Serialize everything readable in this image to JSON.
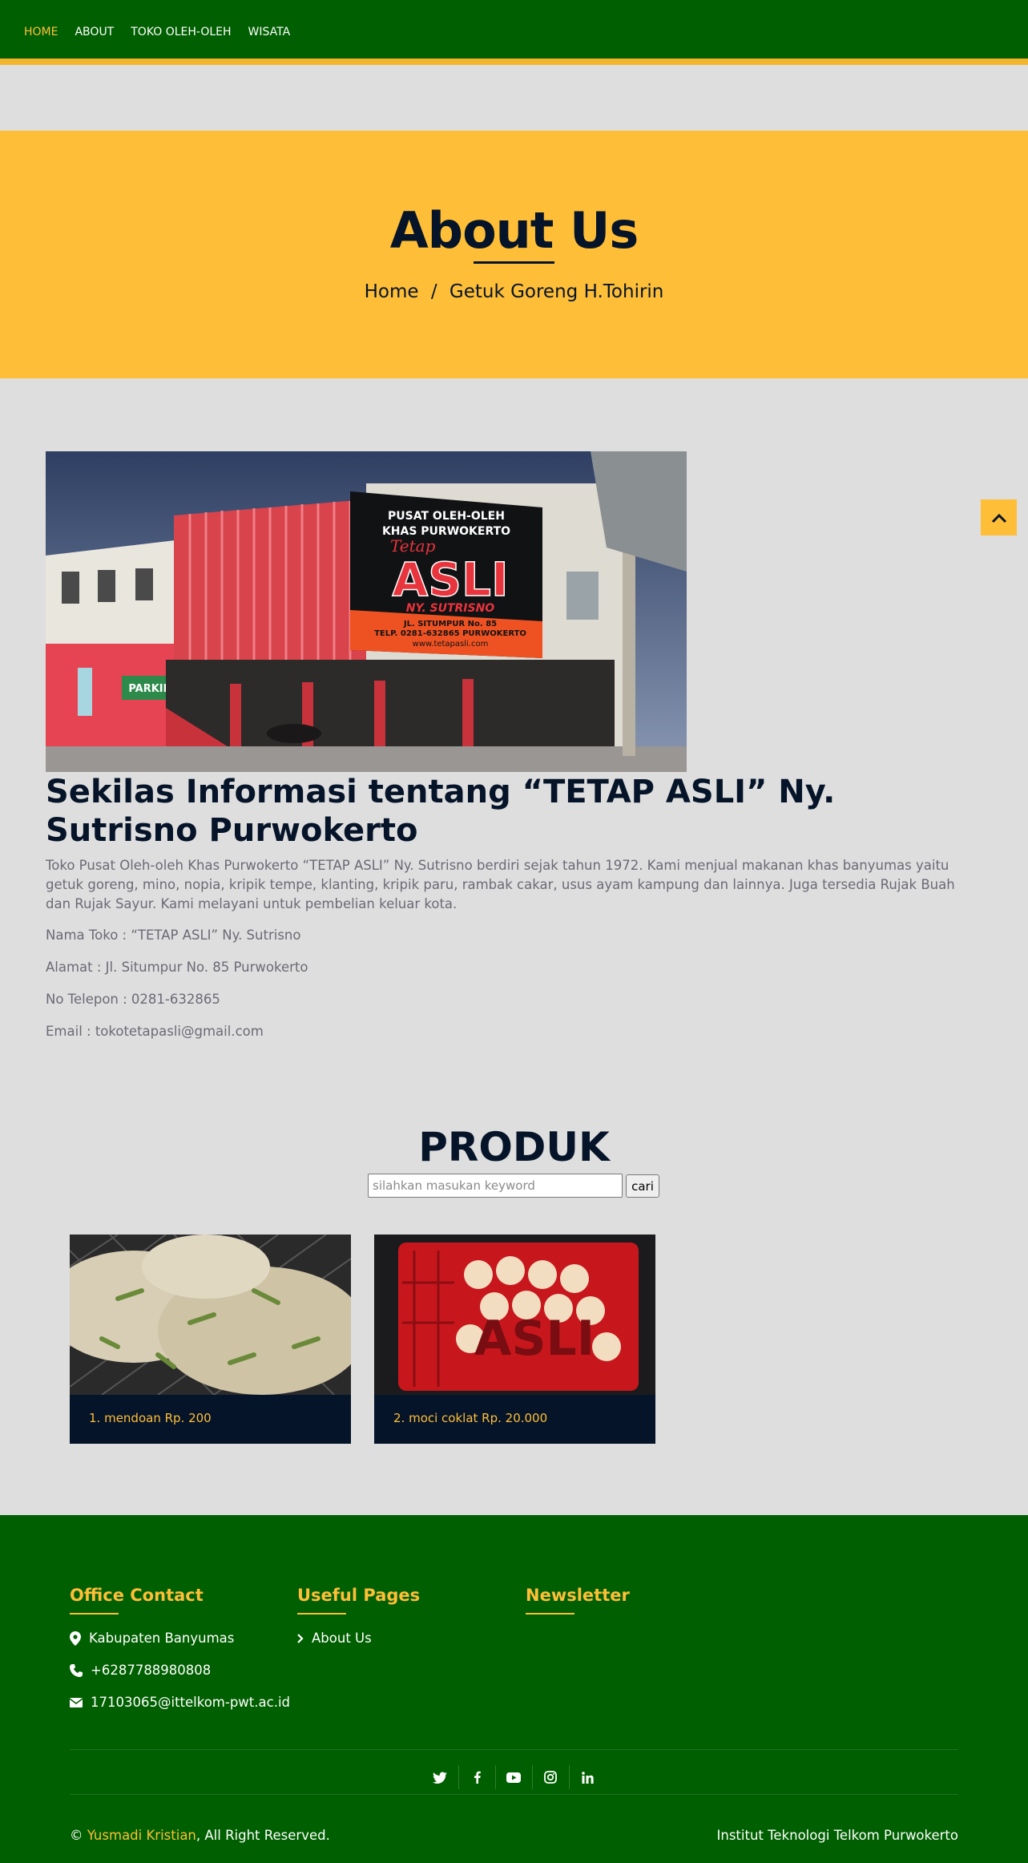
{
  "nav": {
    "items": [
      {
        "label": "HOME",
        "active": true
      },
      {
        "label": "ABOUT",
        "active": false
      },
      {
        "label": "TOKO OLEH-OLEH",
        "active": false
      },
      {
        "label": "WISATA",
        "active": false
      }
    ]
  },
  "hero": {
    "title": "About Us",
    "breadcrumb": {
      "home": "Home",
      "separator": "/",
      "current": "Getuk Goreng H.Tohirin"
    }
  },
  "store_photo": {
    "sign_line1": "PUSAT OLEH-OLEH",
    "sign_line2": "KHAS PURWOKERTO",
    "sign_script": "Tetap",
    "sign_brand": "ASLI",
    "sign_owner": "NY. SUTRISNO",
    "sign_address": "JL. SITUMPUR No. 85",
    "sign_phone": "TELP. 0281-632865 PURWOKERTO",
    "sign_web": "www.tetapasli.com",
    "parkir": "PARKIR"
  },
  "about": {
    "heading": "Sekilas Informasi tentang “TETAP ASLI” Ny. Sutrisno Purwokerto",
    "description": "Toko Pusat Oleh-oleh Khas Purwokerto “TETAP ASLI” Ny. Sutrisno berdiri sejak tahun 1972. Kami menjual makanan khas banyumas yaitu getuk goreng, mino, nopia, kripik tempe, klanting, kripik paru, rambak cakar, usus ayam kampung dan lainnya. Juga tersedia Rujak Buah dan Rujak Sayur. Kami melayani untuk pembelian keluar kota.",
    "store_name": "Nama Toko : “TETAP ASLI” Ny. Sutrisno",
    "address": "Alamat : Jl. Situmpur No. 85 Purwokerto",
    "phone": "No Telepon : 0281-632865",
    "email": "Email : tokotetapasli@gmail.com"
  },
  "produk": {
    "title": "PRODUK",
    "search_placeholder": "silahkan masukan keyword",
    "search_value": "",
    "search_button": "cari",
    "items": [
      {
        "label": "1. mendoan Rp. 200"
      },
      {
        "label": "2. moci coklat Rp. 20.000"
      }
    ],
    "moci_brand": "ASLI"
  },
  "footer": {
    "office": {
      "heading": "Office Contact",
      "location": "Kabupaten Banyumas",
      "phone": "+6287788980808",
      "email": "17103065@ittelkom-pwt.ac.id"
    },
    "useful": {
      "heading": "Useful Pages",
      "links": [
        "About Us"
      ]
    },
    "newsletter": {
      "heading": "Newsletter"
    },
    "social": [
      "twitter-icon",
      "facebook-icon",
      "youtube-icon",
      "instagram-icon",
      "linkedin-icon"
    ],
    "copyright_prefix": "©",
    "copyright_author": "Yusmadi Kristian",
    "copyright_suffix": ", All Right Reserved.",
    "institute": "Institut Teknologi Telkom Purwokerto"
  },
  "colors": {
    "nav_green": "#005f00",
    "accent_yellow": "#febe37",
    "navy": "#061429",
    "page_bg": "#dedede"
  }
}
